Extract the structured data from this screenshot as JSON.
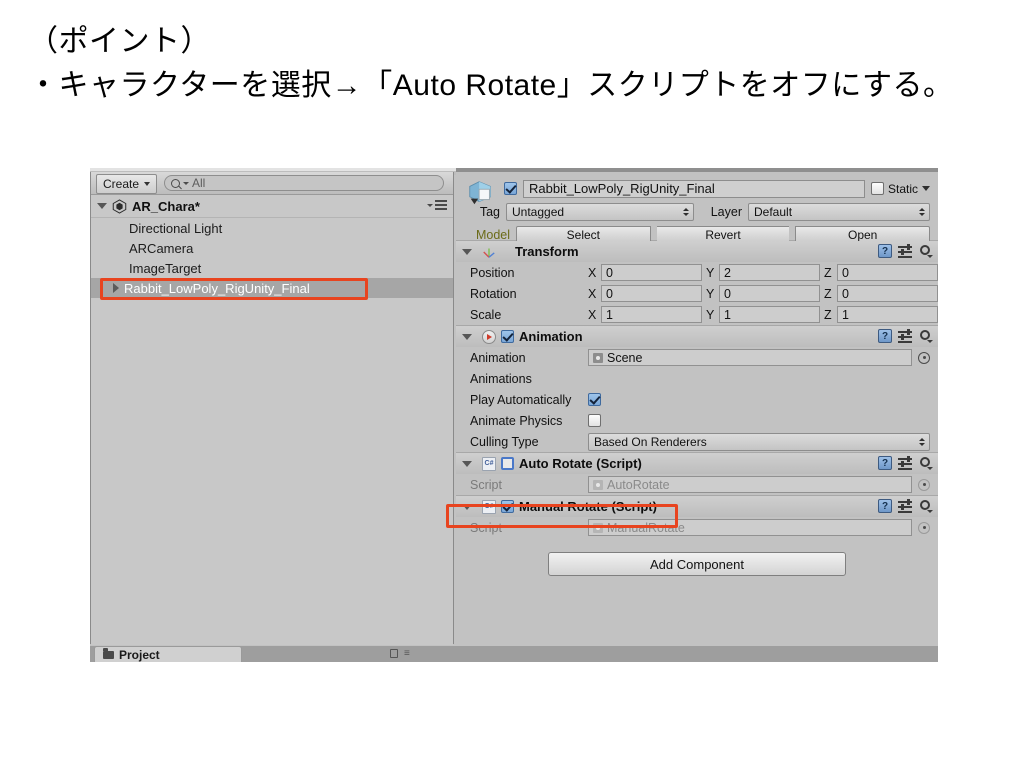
{
  "caption": {
    "line1": "（ポイント）",
    "line2": "・キャラクターを選択→「Auto Rotate」スクリプトをオフにする。"
  },
  "hierarchy": {
    "create_label": "Create",
    "search_placeholder": "All",
    "scene_name": "AR_Chara*",
    "items": [
      {
        "label": "Directional Light",
        "selected": false,
        "expandable": false
      },
      {
        "label": "ARCamera",
        "selected": false,
        "expandable": false
      },
      {
        "label": "ImageTarget",
        "selected": false,
        "expandable": false
      },
      {
        "label": "Rabbit_LowPoly_RigUnity_Final",
        "selected": true,
        "expandable": true
      }
    ]
  },
  "project_tab": {
    "label": "Project"
  },
  "inspector": {
    "object_name": "Rabbit_LowPoly_RigUnity_Final",
    "object_enabled": true,
    "static_label": "Static",
    "static_checked": false,
    "tag_label": "Tag",
    "tag_value": "Untagged",
    "layer_label": "Layer",
    "layer_value": "Default",
    "model_label": "Model",
    "model_buttons": [
      "Select",
      "Revert",
      "Open"
    ],
    "components": [
      {
        "title": "Transform",
        "icon": "transform-icon",
        "has_enable_checkbox": false,
        "rows": [
          {
            "label": "Position",
            "type": "vector3",
            "x": "0",
            "y": "2",
            "z": "0"
          },
          {
            "label": "Rotation",
            "type": "vector3",
            "x": "0",
            "y": "0",
            "z": "0"
          },
          {
            "label": "Scale",
            "type": "vector3",
            "x": "1",
            "y": "1",
            "z": "1"
          }
        ]
      },
      {
        "title": "Animation",
        "icon": "animation-icon",
        "has_enable_checkbox": true,
        "enabled": true,
        "rows": [
          {
            "label": "Animation",
            "type": "object",
            "value": "Scene"
          },
          {
            "label": "Animations",
            "type": "foldout"
          },
          {
            "label": "Play Automatically",
            "type": "checkbox",
            "checked": true
          },
          {
            "label": "Animate Physics",
            "type": "checkbox",
            "checked": false
          },
          {
            "label": "Culling Type",
            "type": "popup",
            "value": "Based On Renderers"
          }
        ]
      },
      {
        "title": "Auto Rotate (Script)",
        "icon": "csharp-script-icon",
        "has_enable_checkbox": true,
        "enabled": false,
        "highlighted": true,
        "rows": [
          {
            "label": "Script",
            "type": "object",
            "value": "AutoRotate",
            "dimmed": true
          }
        ]
      },
      {
        "title": "Manual Rotate (Script)",
        "icon": "csharp-script-icon",
        "has_enable_checkbox": true,
        "enabled": true,
        "rows": [
          {
            "label": "Script",
            "type": "object",
            "value": "ManualRotate",
            "dimmed": true
          }
        ]
      }
    ],
    "add_component_label": "Add Component"
  },
  "colors": {
    "annotation": "#e8441f",
    "panel_bg": "#c2c2c2",
    "hierarchy_bg": "#c8c8c8",
    "selection": "#a6a6a6",
    "prefab_label": "#6b6b18"
  }
}
